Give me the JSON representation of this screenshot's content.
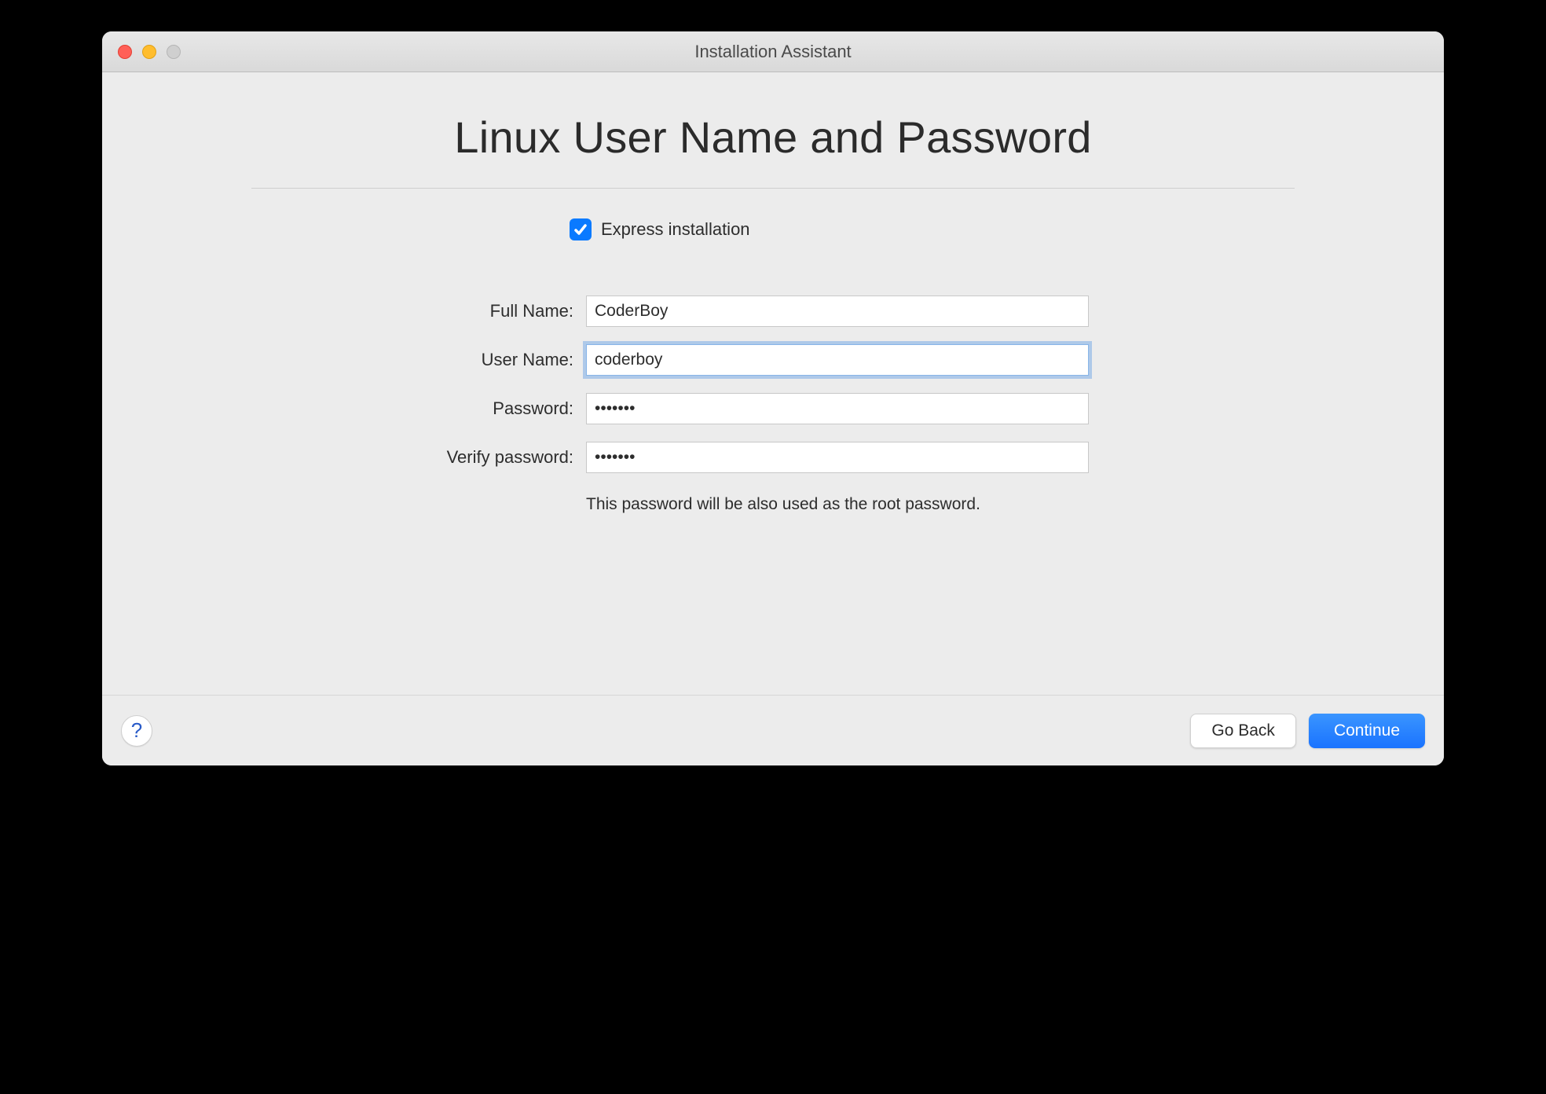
{
  "window": {
    "title": "Installation Assistant"
  },
  "page": {
    "title": "Linux User Name and Password"
  },
  "checkbox": {
    "express_label": "Express installation",
    "express_checked": true
  },
  "form": {
    "full_name_label": "Full Name:",
    "full_name_value": "CoderBoy",
    "user_name_label": "User Name:",
    "user_name_value": "coderboy",
    "password_label": "Password:",
    "password_value": "•••••••",
    "verify_password_label": "Verify password:",
    "verify_password_value": "•••••••",
    "hint": "This password will be also used as the root password."
  },
  "footer": {
    "help_label": "?",
    "go_back_label": "Go Back",
    "continue_label": "Continue"
  }
}
